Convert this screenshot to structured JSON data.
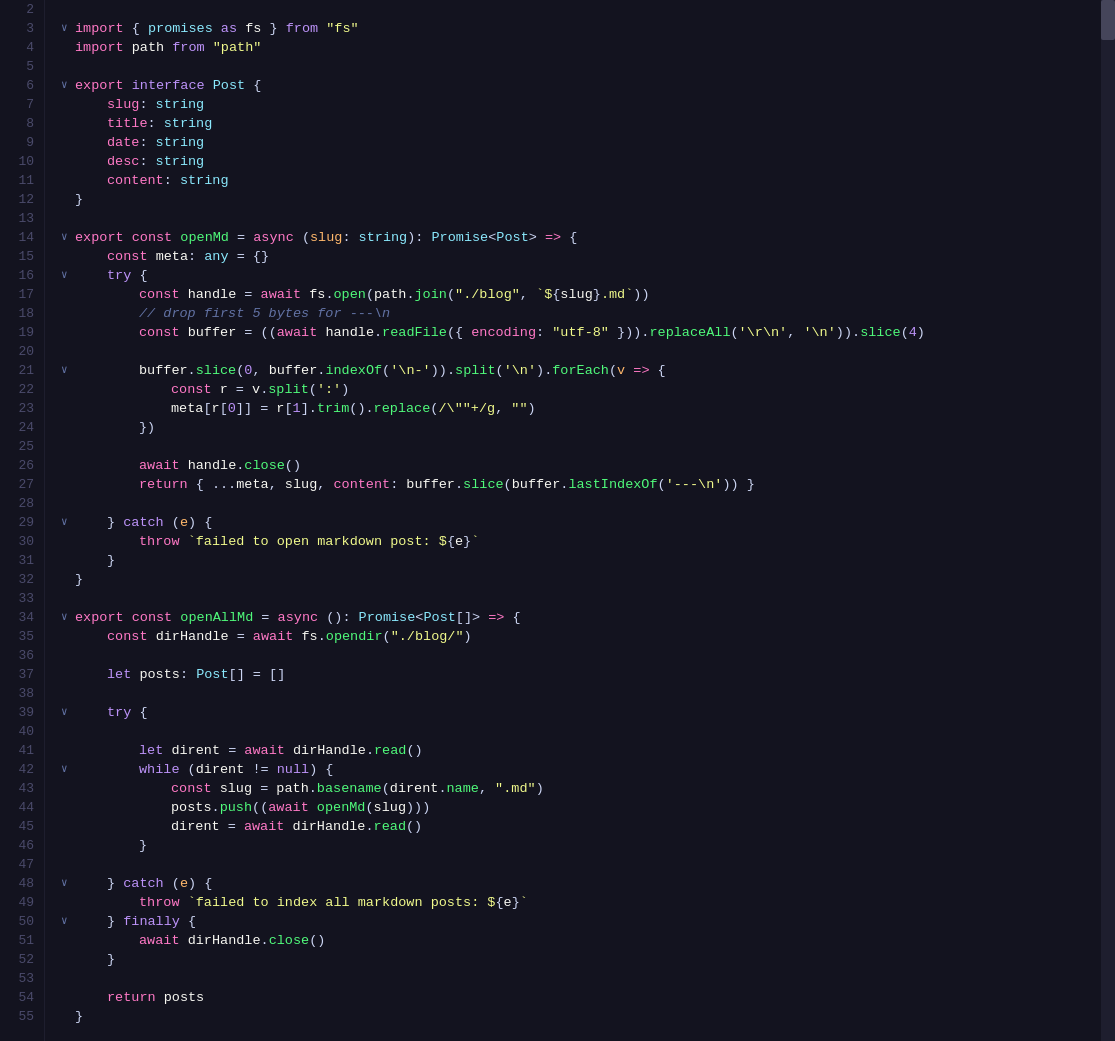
{
  "editor": {
    "background": "#13131f",
    "lineHeight": 19,
    "lines": [
      {
        "num": 2,
        "content": ""
      },
      {
        "num": 3,
        "content": "import_promises_line"
      },
      {
        "num": 4,
        "content": "import_path_line"
      },
      {
        "num": 5,
        "content": ""
      },
      {
        "num": 6,
        "content": "export_interface_line"
      },
      {
        "num": 7,
        "content": "slug_line"
      },
      {
        "num": 8,
        "content": "title_line"
      },
      {
        "num": 9,
        "content": "date_line"
      },
      {
        "num": 10,
        "content": "desc_line"
      },
      {
        "num": 11,
        "content": "content_line"
      },
      {
        "num": 12,
        "content": "close_brace"
      },
      {
        "num": 13,
        "content": ""
      },
      {
        "num": 14,
        "content": "export_openmd"
      },
      {
        "num": 15,
        "content": "const_meta"
      },
      {
        "num": 16,
        "content": "try_open"
      },
      {
        "num": 17,
        "content": "const_handle"
      },
      {
        "num": 18,
        "content": "comment_drop"
      },
      {
        "num": 19,
        "content": "const_buffer"
      },
      {
        "num": 20,
        "content": ""
      },
      {
        "num": 21,
        "content": "buffer_slice"
      },
      {
        "num": 22,
        "content": "const_r"
      },
      {
        "num": 23,
        "content": "meta_assign"
      },
      {
        "num": 24,
        "content": "close_paren_brace"
      },
      {
        "num": 25,
        "content": ""
      },
      {
        "num": 26,
        "content": "await_handle_close"
      },
      {
        "num": 27,
        "content": "return_obj"
      },
      {
        "num": 28,
        "content": ""
      },
      {
        "num": 29,
        "content": "catch_e"
      },
      {
        "num": 30,
        "content": "throw_failed"
      },
      {
        "num": 31,
        "content": "close_brace_1"
      },
      {
        "num": 32,
        "content": "close_brace_2"
      },
      {
        "num": 33,
        "content": ""
      },
      {
        "num": 34,
        "content": "export_openallmd"
      },
      {
        "num": 35,
        "content": "const_dirhandle"
      },
      {
        "num": 36,
        "content": ""
      },
      {
        "num": 37,
        "content": "let_posts"
      },
      {
        "num": 38,
        "content": ""
      },
      {
        "num": 39,
        "content": "try_open_2"
      },
      {
        "num": 40,
        "content": ""
      },
      {
        "num": 41,
        "content": "let_dirent"
      },
      {
        "num": 42,
        "content": "while_dirent"
      },
      {
        "num": 43,
        "content": "const_slug"
      },
      {
        "num": 44,
        "content": "posts_push"
      },
      {
        "num": 45,
        "content": "dirent_assign"
      },
      {
        "num": 46,
        "content": "close_brace_while"
      },
      {
        "num": 47,
        "content": ""
      },
      {
        "num": 48,
        "content": "catch_e_2"
      },
      {
        "num": 49,
        "content": "throw_failed_2"
      },
      {
        "num": 50,
        "content": "finally"
      },
      {
        "num": 51,
        "content": "await_dirhandle_close"
      },
      {
        "num": 52,
        "content": "close_brace_3"
      },
      {
        "num": 53,
        "content": ""
      },
      {
        "num": 54,
        "content": "return_posts"
      },
      {
        "num": 55,
        "content": "close_brace_4"
      }
    ]
  }
}
